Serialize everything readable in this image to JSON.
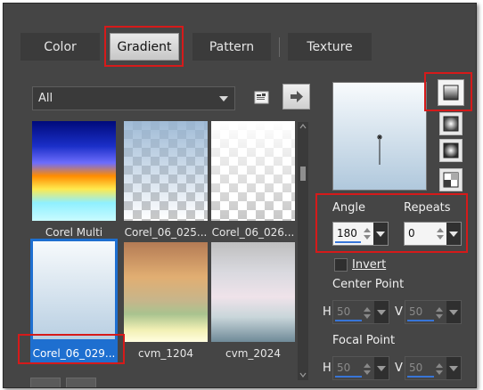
{
  "tabs": [
    {
      "label": "Color",
      "active": false
    },
    {
      "label": "Gradient",
      "active": true
    },
    {
      "label": "Pattern",
      "active": false
    },
    {
      "label": "Texture",
      "active": false
    }
  ],
  "filter": {
    "value": "All"
  },
  "gradients": [
    {
      "label": "Corel Multi",
      "selected": false
    },
    {
      "label": "Corel_06_025...",
      "selected": false
    },
    {
      "label": "Corel_06_026...",
      "selected": false
    },
    {
      "label": "Corel_06_029...",
      "selected": true
    },
    {
      "label": "cvm_1204",
      "selected": false
    },
    {
      "label": "cvm_2024",
      "selected": false
    }
  ],
  "right": {
    "angle_label": "Angle",
    "repeats_label": "Repeats",
    "angle_value": "180",
    "repeats_value": "0",
    "invert_label": "Invert",
    "invert_checked": false,
    "center_point_label": "Center Point",
    "focal_point_label": "Focal Point",
    "center": {
      "h_label": "H",
      "h_value": "50",
      "v_label": "V",
      "v_value": "50"
    },
    "focal": {
      "h_label": "H",
      "h_value": "50",
      "v_label": "V",
      "v_value": "50"
    }
  },
  "colors": {
    "panel": "#454545",
    "highlight": "#d61a1a",
    "selection": "#1e6fd0"
  },
  "icons": [
    "save-preset-icon",
    "arrow-right-icon",
    "linear-style-icon",
    "rectangular-style-icon",
    "sunburst-style-icon",
    "radial-style-icon",
    "angle-dial-icon"
  ]
}
